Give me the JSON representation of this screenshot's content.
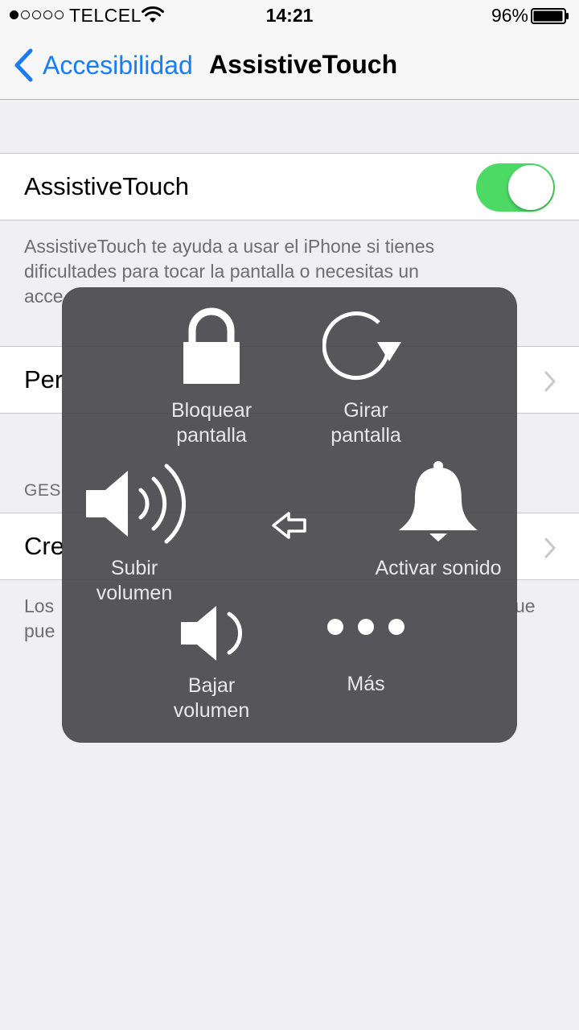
{
  "status_bar": {
    "carrier": "TELCEL",
    "time": "14:21",
    "battery": "96%"
  },
  "nav": {
    "back_label": "Accesibilidad",
    "title": "AssistiveTouch"
  },
  "toggle_cell": {
    "label": "AssistiveTouch",
    "enabled": true
  },
  "description": {
    "line1": "AssistiveTouch te ayuda a usar el iPhone si tienes",
    "line2": "dificultades para tocar la pantalla o necesitas un",
    "line3": "acce"
  },
  "cells": {
    "customize_label": "Per",
    "section_header": "GES",
    "create_label": "Cre",
    "footer_line1": "Los",
    "footer_line1_end": "ue",
    "footer_line2": "pue"
  },
  "assistive_menu": {
    "lock": {
      "line1": "Bloquear",
      "line2": "pantalla",
      "icon": "lock-icon"
    },
    "rotate": {
      "line1": "Girar",
      "line2": "pantalla",
      "icon": "rotate-icon"
    },
    "volume_up": {
      "line1": "Subir",
      "line2": "volumen",
      "icon": "volume-up-icon"
    },
    "back": {
      "icon": "back-arrow-icon"
    },
    "unmute": {
      "label": "Activar sonido",
      "icon": "bell-icon"
    },
    "volume_down": {
      "line1": "Bajar",
      "line2": "volumen",
      "icon": "volume-down-icon"
    },
    "more": {
      "label": "Más",
      "icon": "more-dots-icon"
    }
  },
  "colors": {
    "accent": "#1a7cf2",
    "toggle_on": "#4cd964",
    "menu_bg": "#4a4a4e"
  }
}
